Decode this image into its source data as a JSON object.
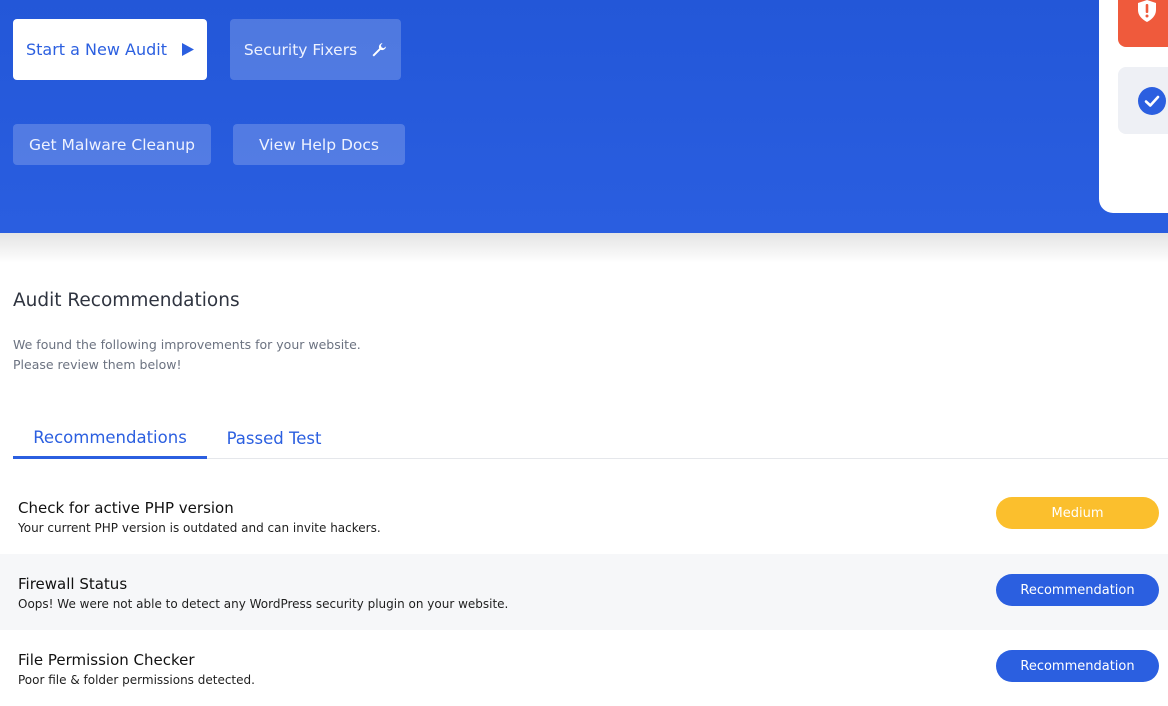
{
  "hero": {
    "buttons": {
      "start_audit": "Start a New Audit",
      "security_fixers": "Security Fixers",
      "malware_cleanup": "Get Malware Cleanup",
      "help_docs": "View Help Docs"
    },
    "icons": {
      "start_audit": "play-icon",
      "security_fixers": "wrench-icon",
      "alert": "shield-alert-icon",
      "check": "check-circle-icon"
    },
    "colors": {
      "background": "#2458db",
      "alert": "#ef5a3c"
    }
  },
  "audit": {
    "title": "Audit Recommendations",
    "subtitle_line1": "We found the following improvements for your website.",
    "subtitle_line2": "Please review them below!",
    "tabs": [
      {
        "label": "Recommendations",
        "active": true
      },
      {
        "label": "Passed Test",
        "active": false
      }
    ],
    "items": [
      {
        "title": "Check for active PHP version",
        "description": "Your current PHP version is outdated and can invite hackers.",
        "badge": "Medium",
        "badge_color": "#fbbf2d"
      },
      {
        "title": "Firewall Status",
        "description": "Oops! We were not able to detect any WordPress security plugin on your website.",
        "badge": "Recommendation",
        "badge_color": "#2b5fe0"
      },
      {
        "title": "File Permission Checker",
        "description": "Poor file & folder permissions detected.",
        "badge": "Recommendation",
        "badge_color": "#2b5fe0"
      }
    ]
  }
}
